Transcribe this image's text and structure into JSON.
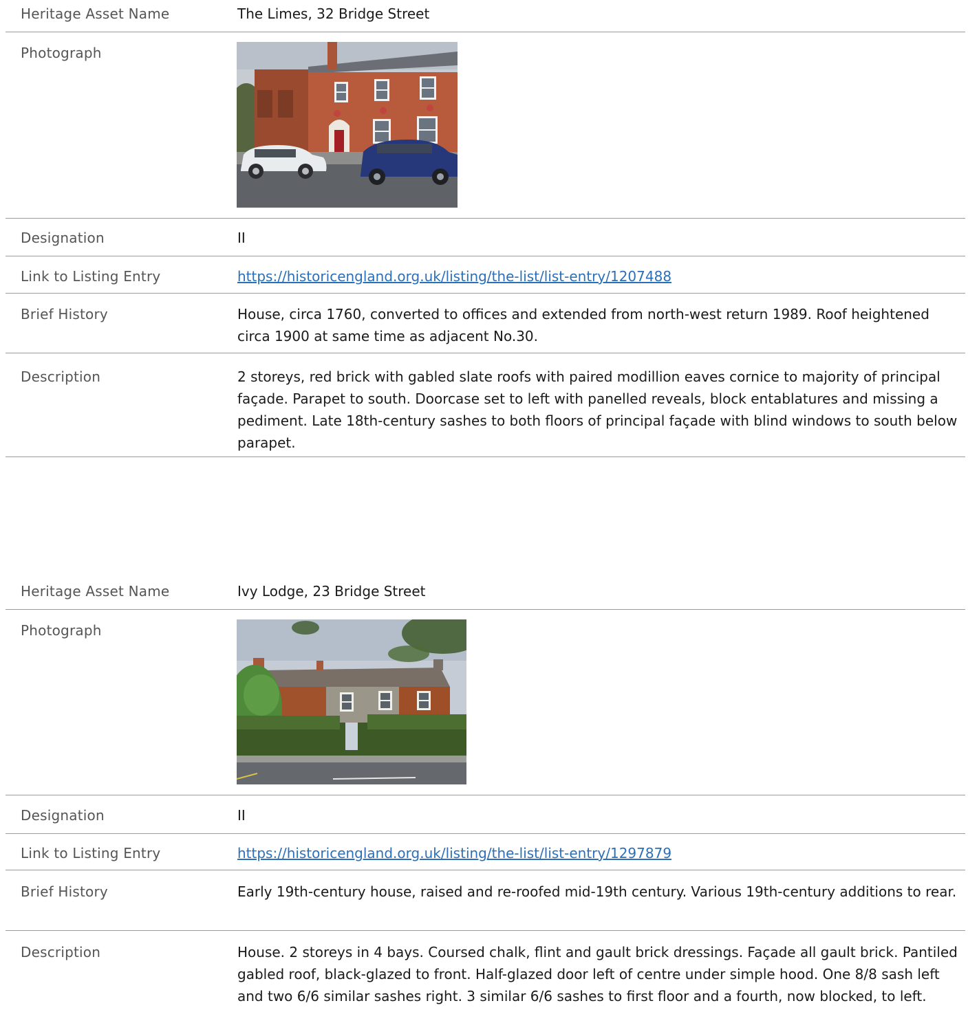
{
  "labels": {
    "name": "Heritage Asset Name",
    "photo": "Photograph",
    "designation": "Designation",
    "link": "Link to Listing Entry",
    "history": "Brief History",
    "description": "Description"
  },
  "assets": [
    {
      "name": "The Limes, 32 Bridge Street",
      "photo_subject": "red-brick-georgian-house-with-parked-cars",
      "designation": "II",
      "link": "https://historicengland.org.uk/listing/the-list/list-entry/1207488",
      "history": "House, circa 1760, converted to offices and extended from north-west return 1989. Roof heightened circa 1900 at same time as adjacent No.30.",
      "description": "2 storeys, red brick with gabled slate roofs with paired modillion eaves cornice to majority of principal façade. Parapet to south. Doorcase set to left with panelled reveals, block entablatures and missing a pediment. Late 18th-century sashes to both floors of principal façade with blind windows to south below parapet."
    },
    {
      "name": "Ivy Lodge, 23 Bridge Street",
      "photo_subject": "ivy-covered-house-behind-hedge",
      "designation": "II",
      "link": "https://historicengland.org.uk/listing/the-list/list-entry/1297879",
      "history": "Early 19th-century house, raised and re-roofed mid-19th century. Various 19th-century additions to rear.",
      "description": "House. 2 storeys in 4 bays. Coursed chalk, flint and gault brick dressings. Façade all gault brick. Pantiled gabled roof, black-glazed to front. Half-glazed door left of centre under simple hood. One 8/8 sash left and two 6/6 similar sashes right. 3 similar 6/6 sashes to first floor and a fourth, now blocked, to left."
    }
  ]
}
